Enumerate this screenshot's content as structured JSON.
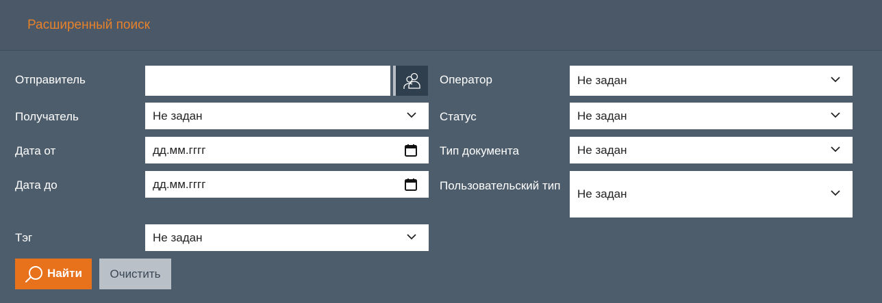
{
  "header": {
    "title": "Расширенный поиск"
  },
  "left": {
    "sender_label": "Отправитель",
    "sender_value": "",
    "recipient_label": "Получатель",
    "recipient_value": "Не задан",
    "date_from_label": "Дата от",
    "date_from_value": "дд.мм.гггг",
    "date_to_label": "Дата до",
    "date_to_value": "дд.мм.гггг",
    "tag_label": "Тэг",
    "tag_value": "Не задан"
  },
  "right": {
    "operator_label": "Оператор",
    "operator_value": "Не задан",
    "status_label": "Статус",
    "status_value": "Не задан",
    "doctype_label": "Тип документа",
    "doctype_value": "Не задан",
    "usertype_label": "Пользовательский тип",
    "usertype_value": "Не задан"
  },
  "actions": {
    "find_label": "Найти",
    "clear_label": "Очистить"
  },
  "icons": {
    "lookup": "users-icon",
    "dropdown": "chevron-down-icon",
    "date": "calendar-icon",
    "find": "search-icon"
  },
  "colors": {
    "accent": "#e8711c",
    "title": "#e8822a",
    "background": "#4d5d6c",
    "header": "#4a5868",
    "clear_button": "#b9c0c8",
    "lookup_button": "#2f3f4e"
  }
}
